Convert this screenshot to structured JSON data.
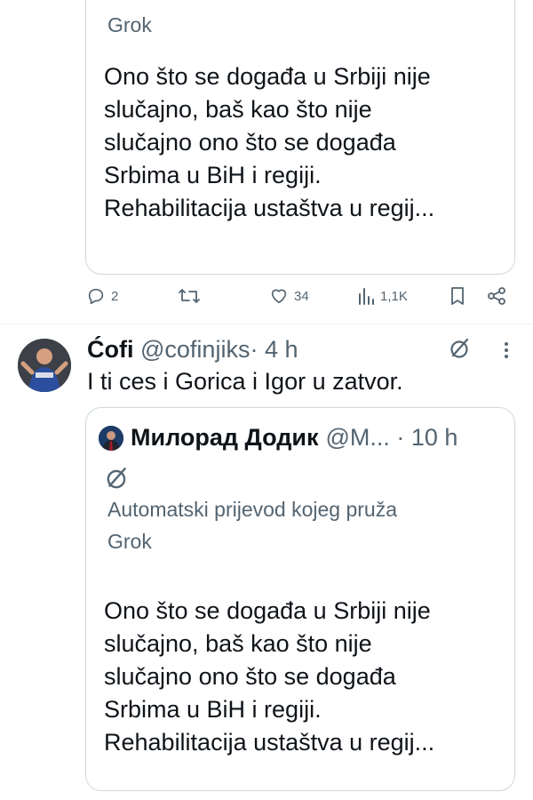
{
  "top_quote": {
    "grok_label": "Grok",
    "text_lines": [
      "Ono što se događa u Srbiji nije",
      "slučajno, baš kao što nije",
      "slučajno ono što se događa",
      "Srbima u BiH i regiji.",
      "Rehabilitacija ustaštva u regij..."
    ]
  },
  "actions": {
    "replies": "2",
    "reposts": "",
    "likes": "34",
    "views": "1,1K"
  },
  "post": {
    "author_name": "Ćofi",
    "author_handle": "@cofinjiks",
    "separator": "·",
    "time": "4 h",
    "text": "I ti ces i Gorica i Igor u zatvor."
  },
  "quote": {
    "author_name": "Милорад Додик",
    "author_handle": "@M...",
    "time_prefix": " · ",
    "time": "10 h",
    "translation_label_1": "Automatski prijevod kojeg pruža",
    "translation_label_2": "Grok",
    "text_lines": [
      "Ono što se događa u Srbiji nije",
      "slučajno, baš kao što nije",
      "slučajno ono što se događa",
      "Srbima u BiH i regiji.",
      "Rehabilitacija ustaštva u regij..."
    ]
  },
  "icons": {
    "reply": "reply-icon",
    "repost": "repost-icon",
    "like": "heart-icon",
    "views": "views-icon",
    "bookmark": "bookmark-icon",
    "share": "share-icon",
    "grok": "grok-icon",
    "more": "more-icon"
  },
  "colors": {
    "text": "#0f1419",
    "muted": "#536471",
    "border": "#cfd9de"
  }
}
